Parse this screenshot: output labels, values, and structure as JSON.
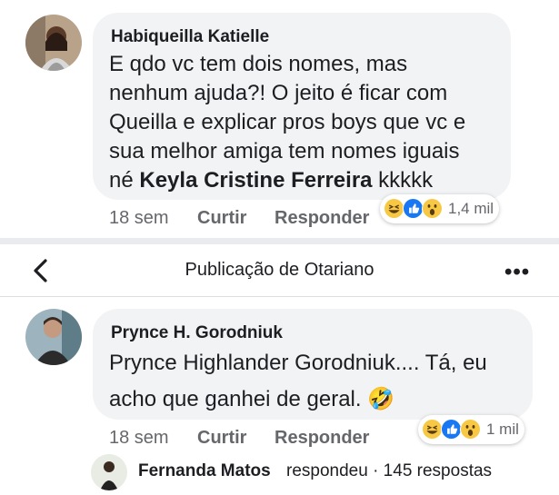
{
  "comment1": {
    "author": "Habiqueilla Katielle",
    "text_line1": "E qdo vc tem dois nomes, mas",
    "text_line2": "nenhum ajuda?! O jeito é ficar com",
    "text_line3": "Queilla e explicar pros boys que vc e",
    "text_line4": "sua melhor amiga tem nomes iguais",
    "text_line5_prefix": "né",
    "mention": "Keyla Cristine Ferreira",
    "text_line5_suffix": "kkkkk",
    "time": "18 sem",
    "like_label": "Curtir",
    "reply_label": "Responder",
    "reaction_count": "1,4 mil",
    "reactions": [
      "haha-icon",
      "like-icon",
      "wow-icon"
    ]
  },
  "header": {
    "title": "Publicação de Otariano",
    "more": "•••"
  },
  "comment2": {
    "author": "Prynce H. Gorodniuk",
    "text_line1": "Prynce Highlander Gorodniuk.... Tá, eu",
    "text_line2": "acho que ganhei de geral. 🤣",
    "time": "18 sem",
    "like_label": "Curtir",
    "reply_label": "Responder",
    "reaction_count": "1 mil",
    "reactions": [
      "haha-icon",
      "like-icon",
      "wow-icon"
    ]
  },
  "reply_summary": {
    "name": "Fernanda Matos",
    "action": "respondeu · 145 respostas"
  },
  "colors": {
    "bubble": "#f2f3f5",
    "divider": "#e9ebee",
    "like_blue": "#1877f2",
    "reaction_yellow": "#f7c843",
    "meta_gray": "#65676b"
  }
}
